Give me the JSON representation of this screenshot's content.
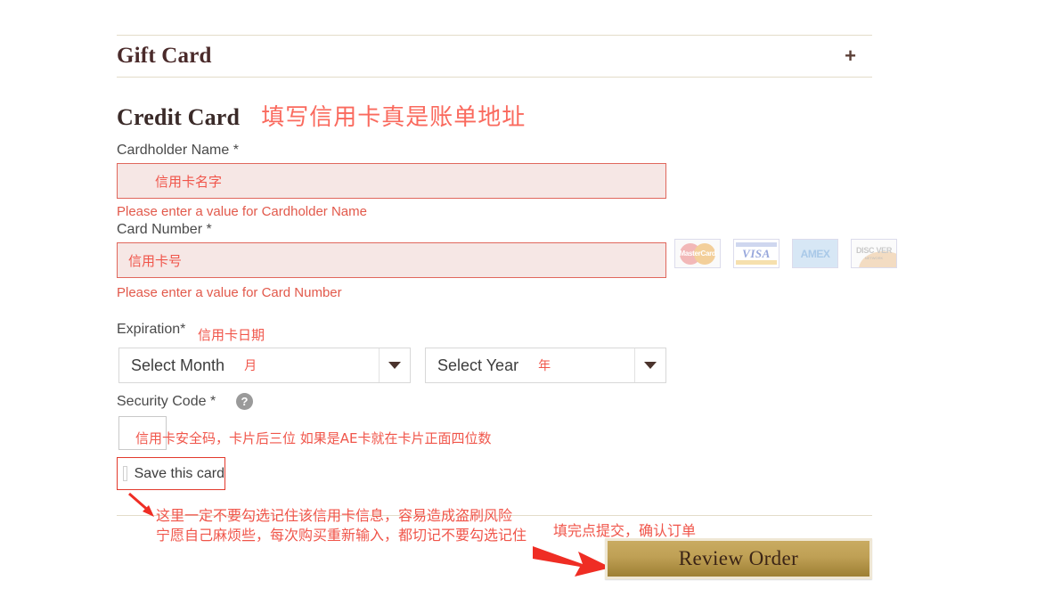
{
  "gift_card": {
    "title": "Gift Card",
    "expand_symbol": "+"
  },
  "credit_card": {
    "title": "Credit Card",
    "annotation": "填写信用卡真是账单地址",
    "cardholder": {
      "label": "Cardholder Name *",
      "placeholder": "信用卡名字",
      "error": "Please enter a value for Cardholder Name"
    },
    "card_number": {
      "label": "Card Number *",
      "placeholder": "信用卡号",
      "error": "Please enter a value for Card Number"
    },
    "brands": [
      {
        "name": "MasterCard",
        "text": "MasterCard"
      },
      {
        "name": "VISA",
        "text": "VISA"
      },
      {
        "name": "AMEX",
        "text": "AMEX"
      },
      {
        "name": "DISCOVER",
        "text": "DISC VER",
        "sub": "NETWORK"
      }
    ],
    "expiration": {
      "label": "Expiration*",
      "annotation": "信用卡日期",
      "month": {
        "value": "Select Month",
        "annotation": "月"
      },
      "year": {
        "value": "Select Year",
        "annotation": "年"
      }
    },
    "security_code": {
      "label": "Security Code *",
      "help_symbol": "?",
      "value": "",
      "annotation": "信用卡安全码，卡片后三位 如果是AE卡就在卡片正面四位数"
    },
    "save_card": {
      "label": "Save this card",
      "checked": false
    }
  },
  "notes": {
    "save_warning_line1": "这里一定不要勾选记住该信用卡信息，容易造成盗刷风险",
    "save_warning_line2": "宁愿自己麻烦些，每次购买重新输入，都切记不要勾选记住",
    "submit_note": "填完点提交，确认订单"
  },
  "review_order": {
    "label": "Review Order"
  },
  "colors": {
    "annotation_red": "#f0554a",
    "error_red": "#e2594b",
    "heading_brown": "#3a2a28",
    "divider_beige": "#e3dcc9",
    "button_gold": "#bfa055",
    "arrow_red": "#ef2d24"
  }
}
